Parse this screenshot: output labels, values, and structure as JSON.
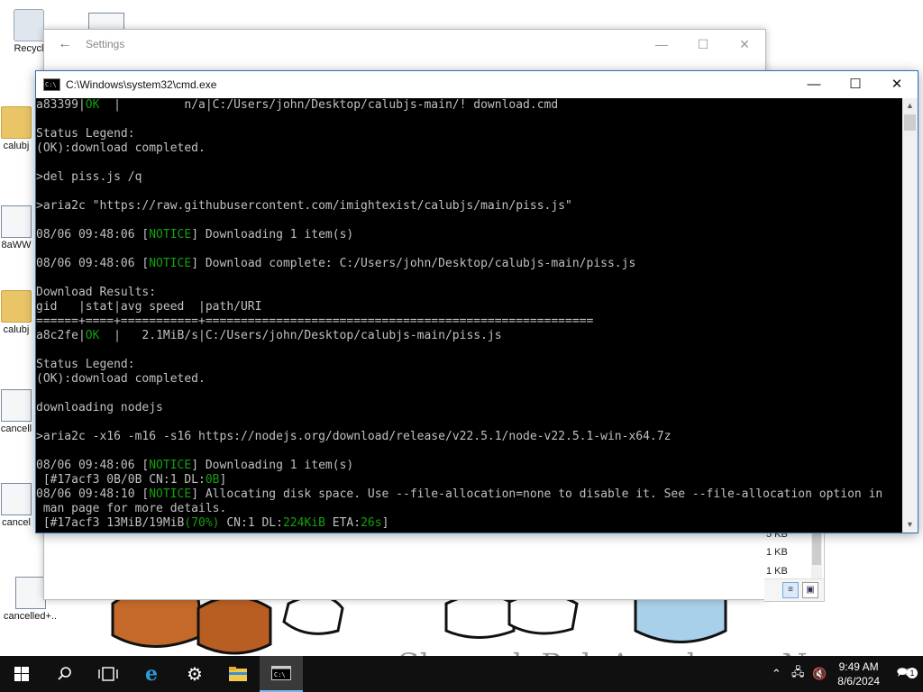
{
  "desktop": {
    "icons": [
      {
        "label": "Recycl",
        "icon": "recycle-bin-icon"
      },
      {
        "label": "calubj",
        "icon": "folder-icon"
      },
      {
        "label": "8aWW",
        "icon": "file-icon"
      },
      {
        "label": "calubj",
        "icon": "folder-icon"
      },
      {
        "label": "cancell",
        "icon": "file-icon"
      },
      {
        "label": "cancel",
        "icon": "settings-file-icon"
      },
      {
        "label": "cancelled+...",
        "icon": "settings-file-icon"
      }
    ],
    "wallpaper_text": "CherrydoBoloAconha on Newgrounds"
  },
  "settings_window": {
    "title": "Settings"
  },
  "explorer_fragment": {
    "sizes": [
      "5 KB",
      "1 KB",
      "1 KB"
    ]
  },
  "cmd_window": {
    "title": "C:\\Windows\\system32\\cmd.exe",
    "colors": {
      "background": "#000000",
      "text": "#c0c0c0",
      "green": "#13a10e"
    },
    "lines": [
      [
        {
          "t": "a83399|"
        },
        {
          "t": "OK",
          "c": "green"
        },
        {
          "t": "  |         n/a|C:/Users/john/Desktop/calubjs-main/! download.cmd"
        }
      ],
      [],
      [
        {
          "t": "Status Legend:"
        }
      ],
      [
        {
          "t": "(OK):download completed."
        }
      ],
      [],
      [
        {
          "t": ">del piss.js /q"
        }
      ],
      [],
      [
        {
          "t": ">aria2c \"https://raw.githubusercontent.com/imightexist/calubjs/main/piss.js\""
        }
      ],
      [],
      [
        {
          "t": "08/06 09:48:06 ["
        },
        {
          "t": "NOTICE",
          "c": "green"
        },
        {
          "t": "] Downloading 1 item(s)"
        }
      ],
      [],
      [
        {
          "t": "08/06 09:48:06 ["
        },
        {
          "t": "NOTICE",
          "c": "green"
        },
        {
          "t": "] Download complete: C:/Users/john/Desktop/calubjs-main/piss.js"
        }
      ],
      [],
      [
        {
          "t": "Download Results:"
        }
      ],
      [
        {
          "t": "gid   |stat|avg speed  |path/URI"
        }
      ],
      [
        {
          "t": "======+====+===========+======================================================="
        }
      ],
      [
        {
          "t": "a8c2fe|"
        },
        {
          "t": "OK",
          "c": "green"
        },
        {
          "t": "  |   2.1MiB/s|C:/Users/john/Desktop/calubjs-main/piss.js"
        }
      ],
      [],
      [
        {
          "t": "Status Legend:"
        }
      ],
      [
        {
          "t": "(OK):download completed."
        }
      ],
      [],
      [
        {
          "t": "downloading nodejs"
        }
      ],
      [],
      [
        {
          "t": ">aria2c -x16 -m16 -s16 https://nodejs.org/download/release/v22.5.1/node-v22.5.1-win-x64.7z"
        }
      ],
      [],
      [
        {
          "t": "08/06 09:48:06 ["
        },
        {
          "t": "NOTICE",
          "c": "green"
        },
        {
          "t": "] Downloading 1 item(s)"
        }
      ],
      [
        {
          "t": " [#17acf3 0B/0B CN:1 DL:"
        },
        {
          "t": "0B",
          "c": "green"
        },
        {
          "t": "]"
        }
      ],
      [
        {
          "t": "08/06 09:48:10 ["
        },
        {
          "t": "NOTICE",
          "c": "green"
        },
        {
          "t": "] Allocating disk space. Use --file-allocation=none to disable it. See --file-allocation option in"
        }
      ],
      [
        {
          "t": " man page for more details."
        }
      ],
      [
        {
          "t": " [#17acf3 13MiB/19MiB"
        },
        {
          "t": "(70%)",
          "c": "green"
        },
        {
          "t": " CN:1 DL:"
        },
        {
          "t": "224KiB",
          "c": "green"
        },
        {
          "t": " ETA:"
        },
        {
          "t": "26s",
          "c": "green"
        },
        {
          "t": "]"
        }
      ]
    ]
  },
  "taskbar": {
    "buttons": [
      {
        "name": "start-button",
        "icon": "windows-logo-icon"
      },
      {
        "name": "search-button",
        "icon": "search-icon"
      },
      {
        "name": "task-view-button",
        "icon": "task-view-icon"
      },
      {
        "name": "internet-explorer-button",
        "icon": "internet-explorer-icon"
      },
      {
        "name": "settings-button",
        "icon": "gear-icon"
      },
      {
        "name": "file-explorer-button",
        "icon": "folder-icon"
      },
      {
        "name": "cmd-button",
        "icon": "cmd-icon",
        "active": true
      }
    ],
    "clock": {
      "time": "9:49 AM",
      "date": "8/6/2024"
    },
    "notification_count": "1"
  }
}
